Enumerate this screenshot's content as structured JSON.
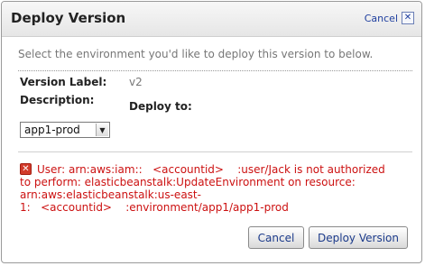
{
  "dialog": {
    "title": "Deploy Version",
    "close_label": "Cancel",
    "close_icon_glyph": "✕"
  },
  "intro_text": "Select the environment you'd like to deploy this version to below.",
  "form": {
    "version_label": "Version Label:",
    "version_value": "v2",
    "description_label": "Description:",
    "deploy_to_label": "Deploy to:",
    "environment_selected": "app1-prod",
    "dropdown_icon_glyph": "▼"
  },
  "error": {
    "icon_glyph": "✕",
    "lines": [
      "User: arn:aws:iam::   <accountid>    :user/Jack is not authorized",
      "to perform: elasticbeanstalk:UpdateEnvironment on resource:",
      "arn:aws:elasticbeanstalk:us-east-",
      "1:   <accountid>    :environment/app1/app1-prod"
    ]
  },
  "buttons": {
    "cancel": "Cancel",
    "deploy": "Deploy Version"
  },
  "colors": {
    "error_text": "#cc1111",
    "link_text": "#1f3f9f"
  }
}
